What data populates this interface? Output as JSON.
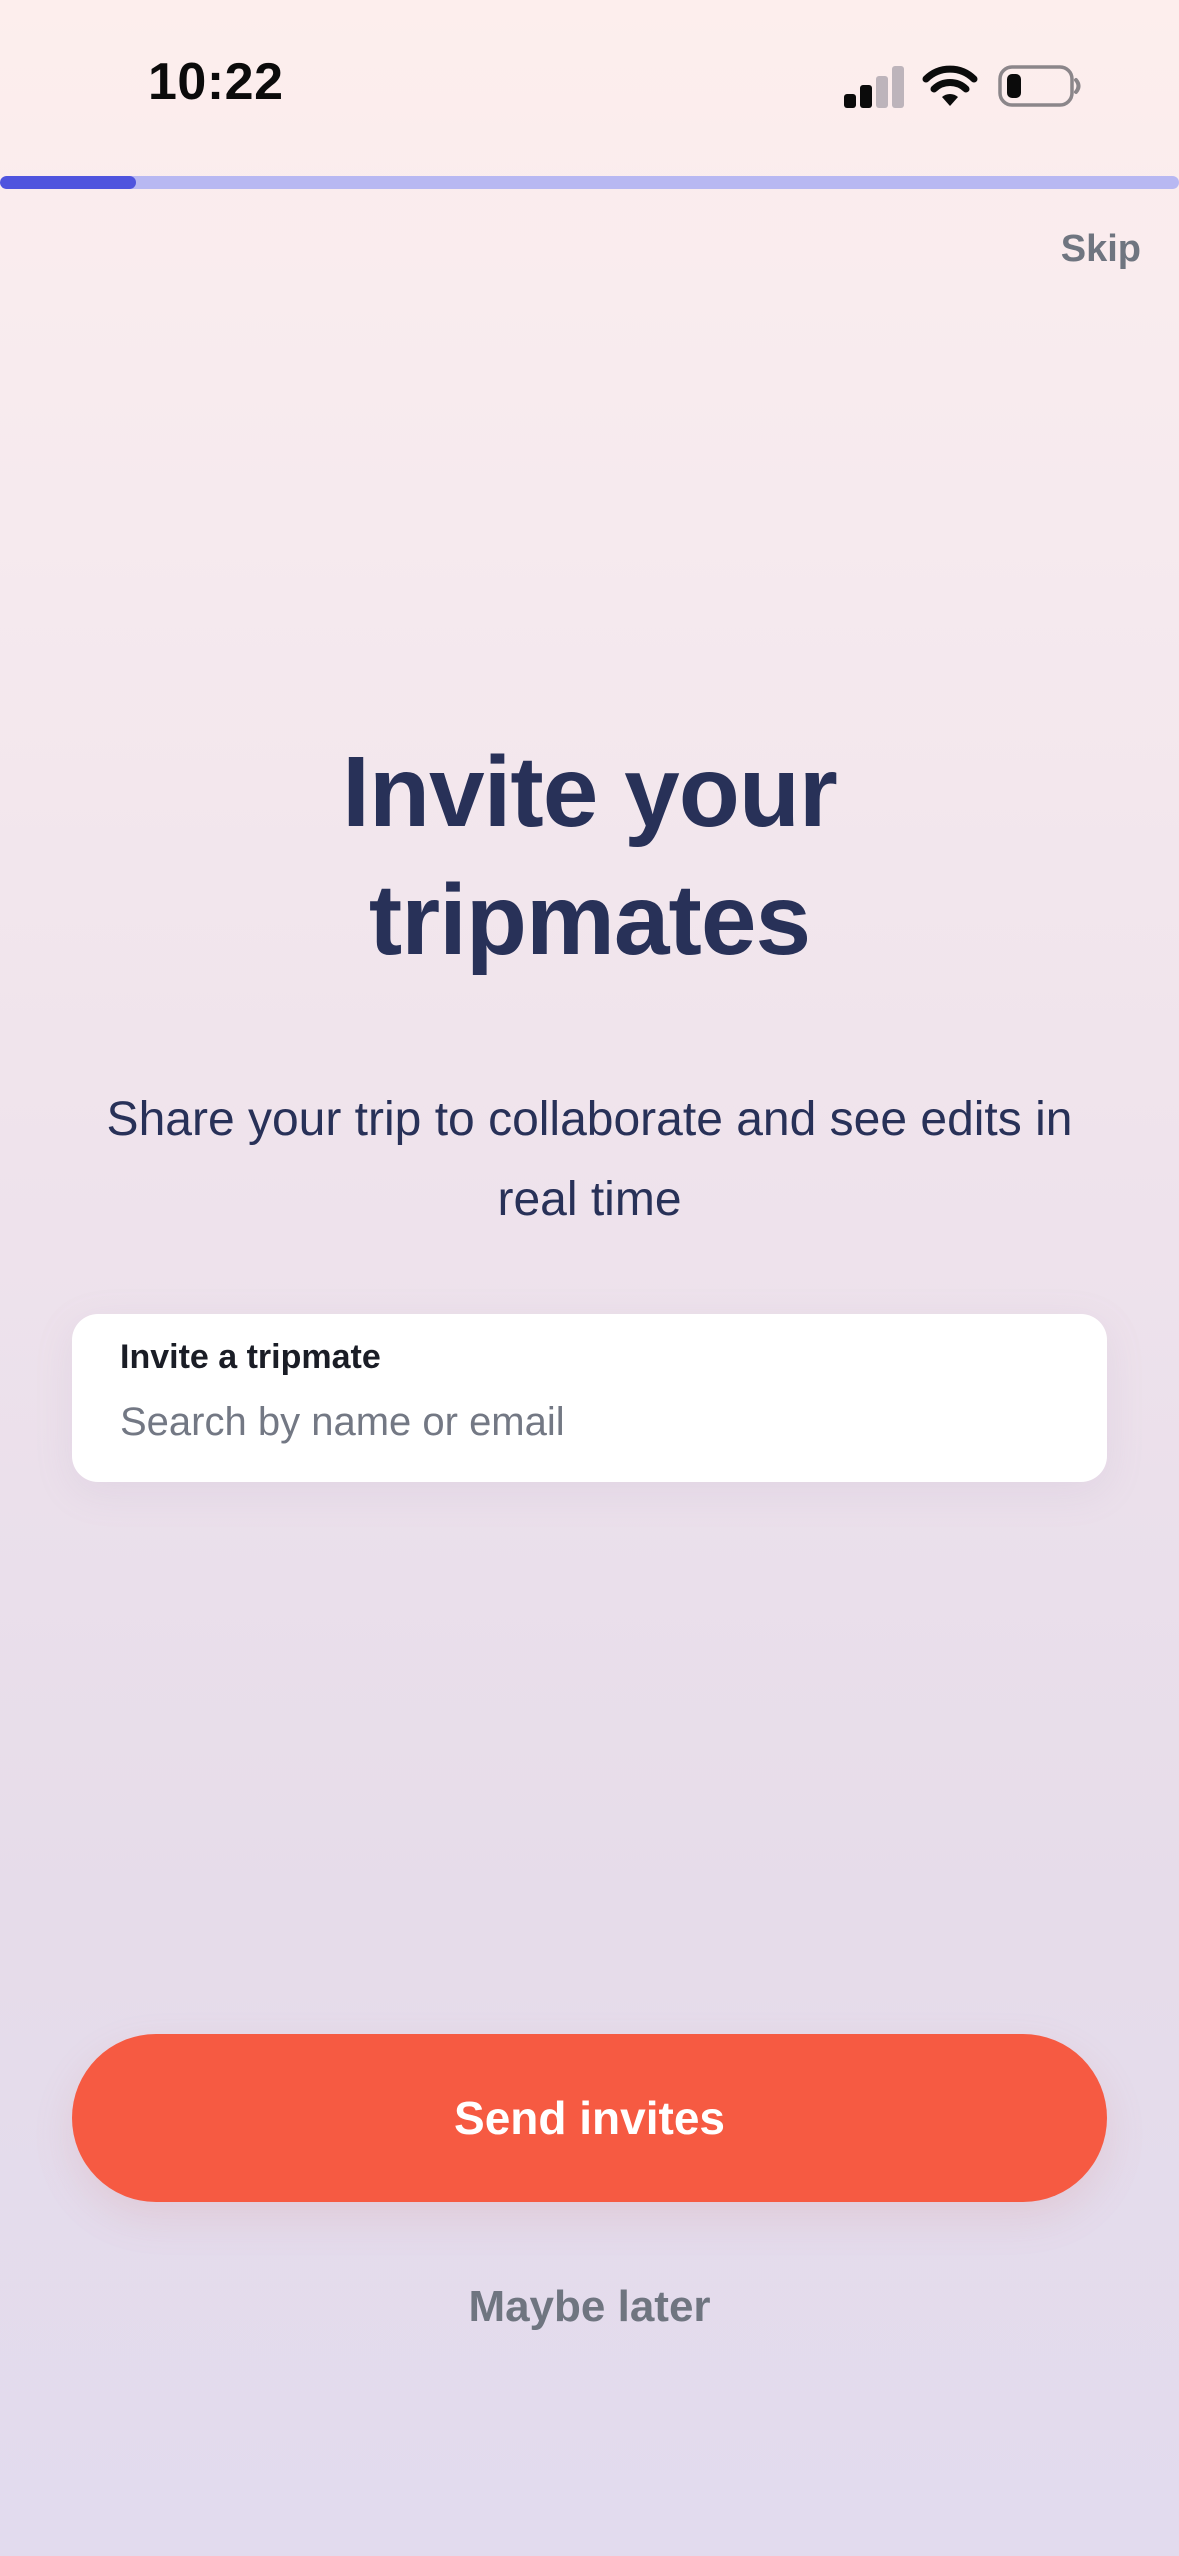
{
  "status_bar": {
    "time": "10:22",
    "icons": [
      "signal-icon",
      "wifi-icon",
      "battery-icon"
    ]
  },
  "progress": {
    "fraction": 0.115
  },
  "header": {
    "skip_label": "Skip"
  },
  "main": {
    "title_line1": "Invite your",
    "title_line2": "tripmates",
    "subtitle_line1": "Share your trip to collaborate and see edits in",
    "subtitle_line2": "real time"
  },
  "invite": {
    "label": "Invite a tripmate",
    "value": "",
    "placeholder": "Search by name or email"
  },
  "actions": {
    "send_label": "Send invites",
    "later_label": "Maybe later"
  },
  "colors": {
    "accent": "#f65a42",
    "title": "#283158",
    "progress_fill": "#4f54de",
    "progress_track": "#b8b8f2",
    "muted_text": "#6f7580"
  }
}
